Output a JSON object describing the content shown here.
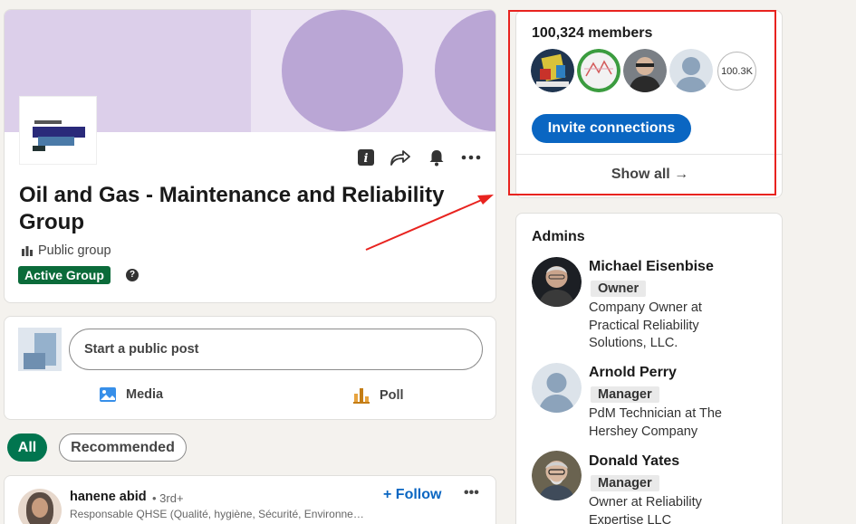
{
  "group": {
    "title": "Oil and Gas - Maintenance and Reliability Group",
    "visibility": "Public group",
    "badge": "Active Group",
    "help_glyph": "?",
    "info_glyph": "i"
  },
  "composer": {
    "placeholder": "Start a public post",
    "media_label": "Media",
    "poll_label": "Poll"
  },
  "filters": [
    "All",
    "Recommended"
  ],
  "feed": {
    "post": {
      "author": "hanene abid",
      "degree": "• 3rd+",
      "headline": "Responsable QHSE (Qualité, hygiène, Sécurité, Environnement)",
      "follow_label": "+ Follow",
      "more_label": "•••"
    }
  },
  "members": {
    "count_label": "100,324 members",
    "overflow_count": "100.3K",
    "invite_label": "Invite connections",
    "show_all_label": "Show all →"
  },
  "admins": {
    "title": "Admins",
    "list": [
      {
        "name": "Michael Eisenbise",
        "role": "Owner",
        "headline_lines": [
          "Company Owner at",
          "Practical Reliability",
          "Solutions, LLC."
        ]
      },
      {
        "name": "Arnold Perry",
        "role": "Manager",
        "headline_lines": [
          "PdM Technician at The",
          "Hershey Company"
        ]
      },
      {
        "name": "Donald Yates",
        "role": "Manager",
        "headline_lines": [
          "Owner at Reliability",
          "Expertise LLC"
        ]
      }
    ]
  },
  "colors": {
    "brand_blue": "#0a66c2",
    "active_green": "#01754f",
    "badge_green": "#0b6b3a",
    "cover_purple": "#baa6d5",
    "annotation_red": "#e8231f"
  },
  "icons": [
    "info-icon",
    "share-icon",
    "bell-icon",
    "more-icon",
    "group-icon",
    "help-icon",
    "media-icon",
    "poll-icon",
    "arrow-right-icon"
  ]
}
